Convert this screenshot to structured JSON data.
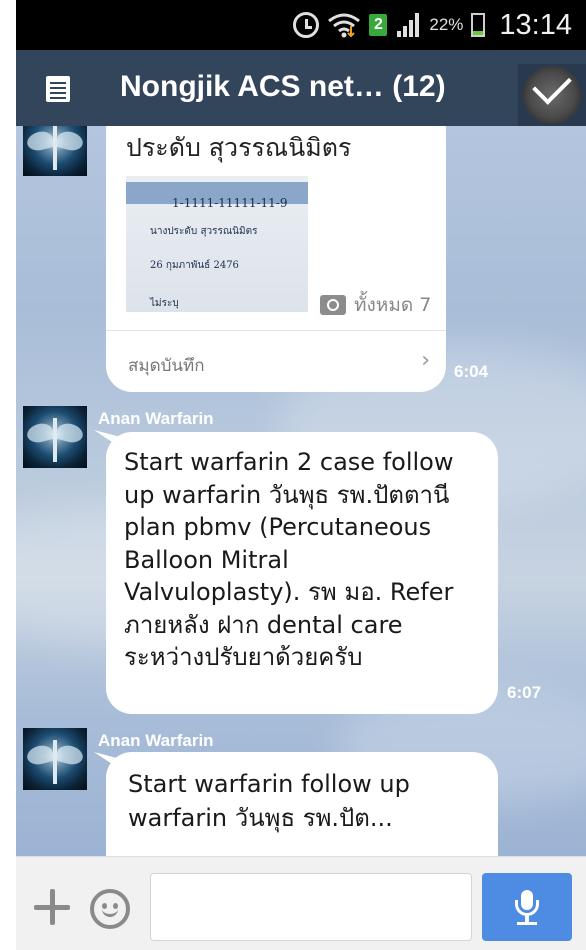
{
  "status_bar": {
    "sim_slot": "2",
    "battery_percent": "22%",
    "battery_level": 0.22,
    "time": "13:14"
  },
  "header": {
    "title": "Nongjik ACS net…  (12)",
    "menu_icon": "note-list-icon",
    "action_icon": "check-icon"
  },
  "messages": [
    {
      "type": "album_post",
      "text": "ประดับ  สุวรรณนิมิตร",
      "photo_lines": [
        "1-1111-11111-11-9",
        "นางประดับ สุวรรณนิมิตร",
        "26 กุมภาพันธ์ 2476",
        "ไม่ระบุ"
      ],
      "photo_count_label": "ทั้งหมด 7",
      "footer_label": "สมุดบันทึก",
      "time": "6:04"
    },
    {
      "type": "text",
      "sender": "Anan Warfarin",
      "lines": [
        "Start warfarin 2 case follow",
        "up warfarin วันพุธ   รพ.ปัตตานี",
        "plan pbmv (Percutaneous",
        "Balloon Mitral",
        "Valvuloplasty). รพ มอ. Refer",
        "ภายหลัง ฝาก dental care",
        "ระหว่างปรับยาด้วยครับ"
      ],
      "time": "6:07"
    },
    {
      "type": "text",
      "sender": "Anan Warfarin",
      "lines": [
        "Start warfarin follow up",
        "warfarin วันพุธ   รพ.ปัต..."
      ]
    }
  ],
  "input": {
    "value": "",
    "placeholder": ""
  },
  "colors": {
    "header_bg": "#33455b",
    "send_button": "#4e8ce4"
  }
}
